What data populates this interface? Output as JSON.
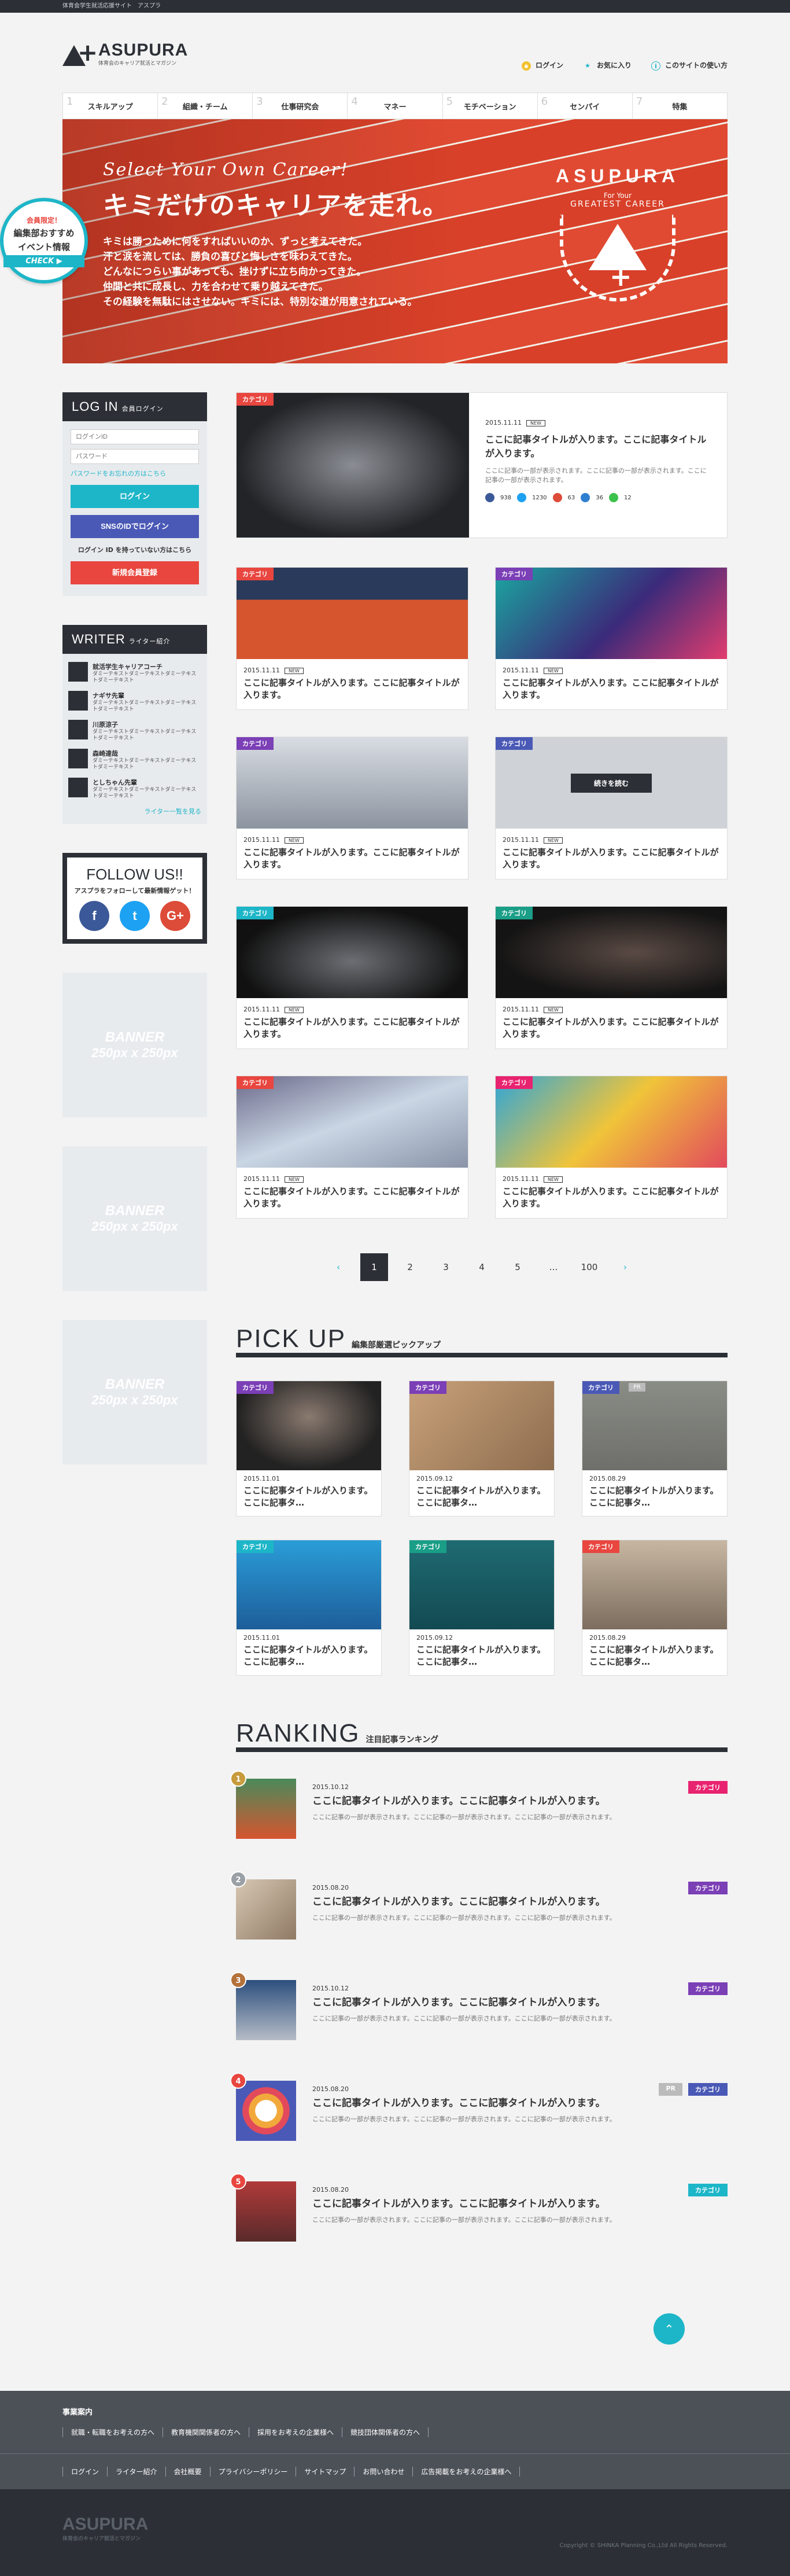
{
  "topbar": {
    "text": "体育会学生就活応援サイト　アスプラ"
  },
  "header": {
    "logo": "ASUPURA",
    "logo_sub": "体育会のキャリア就活とマガジン",
    "links": [
      {
        "label": "ログイン",
        "icon": "lock-icon"
      },
      {
        "label": "お気に入り",
        "icon": "star-icon"
      },
      {
        "label": "このサイトの使い方",
        "icon": "info-icon"
      }
    ]
  },
  "nav": [
    {
      "num": "1",
      "label": "スキルアップ"
    },
    {
      "num": "2",
      "label": "組織・チーム"
    },
    {
      "num": "3",
      "label": "仕事研究会"
    },
    {
      "num": "4",
      "label": "マネー"
    },
    {
      "num": "5",
      "label": "モチベーション"
    },
    {
      "num": "6",
      "label": "センパイ"
    },
    {
      "num": "7",
      "label": "特集"
    }
  ],
  "hero": {
    "en": "Select Your Own Career!",
    "title": "キミだけのキャリアを走れ。",
    "lines": [
      "キミは勝つために何をすればいいのか、ずっと考えてきた。",
      "汗と涙を流しては、勝負の喜びと悔しさを味わえてきた。",
      "どんなにつらい事があっても、挫けずに立ち向かってきた。",
      "仲間と共に成長し、力を合わせて乗り越えてきた。",
      "その経験を無駄にはさせない。キミには、特別な道が用意されている。"
    ],
    "badge_arc": "ASUPURA",
    "badge_for": "For Your",
    "badge_great": "GREATEST CAREER"
  },
  "side_tab": {
    "limited": "会員限定！",
    "title1": "編集部おすすめ",
    "title2": "イベント情報",
    "check": "CHECK ▶"
  },
  "login": {
    "title": "LOG IN",
    "title_sub": "会員ログイン",
    "id_placeholder": "ログインID",
    "pw_placeholder": "パスワード",
    "forgot": "パスワードをお忘れの方はこちら",
    "login_btn": "ログイン",
    "sns_btn": "SNSのIDでログイン",
    "note": "ログイン ID を持っていない方はこちら",
    "register_btn": "新規会員登録"
  },
  "writer": {
    "title": "WRITER",
    "title_sub": "ライター紹介",
    "items": [
      {
        "name": "就活学生キャリアコーチ",
        "desc": "ダミーテキストダミーテキストダミーテキストダミーテキスト"
      },
      {
        "name": "ナギサ先輩",
        "desc": "ダミーテキストダミーテキストダミーテキストダミーテキスト"
      },
      {
        "name": "川原涼子",
        "desc": "ダミーテキストダミーテキストダミーテキストダミーテキスト"
      },
      {
        "name": "森崎達哉",
        "desc": "ダミーテキストダミーテキストダミーテキストダミーテキスト"
      },
      {
        "name": "としちゃん先輩",
        "desc": "ダミーテキストダミーテキストダミーテキストダミーテキスト"
      }
    ],
    "more": "ライター一覧を見る"
  },
  "follow": {
    "title": "FOLLOW US!!",
    "sub": "アスプラをフォローして最新情報ゲット！",
    "sns": [
      "f",
      "t",
      "G+"
    ]
  },
  "banner": {
    "line1": "BANNER",
    "line2": "250px x 250px"
  },
  "featured": {
    "cat": "カテゴリ",
    "date": "2015.11.11",
    "new": "NEW",
    "title": "ここに記事タイトルが入ります。ここに記事タイトルが入ります。",
    "text": "ここに記事の一部が表示されます。ここに記事の一部が表示されます。ここに記事の一部が表示されます。",
    "counts": [
      "938",
      "1230",
      "63",
      "36",
      "12"
    ]
  },
  "articles": [
    {
      "cat": "カテゴリ",
      "cat_color": "#e8463f",
      "date": "2015.11.11",
      "new": "NEW",
      "title": "ここに記事タイトルが入ります。ここに記事タイトルが入ります。"
    },
    {
      "cat": "カテゴリ",
      "cat_color": "#7b3fb6",
      "date": "2015.11.11",
      "new": "NEW",
      "title": "ここに記事タイトルが入ります。ここに記事タイトルが入ります。"
    },
    {
      "cat": "カテゴリ",
      "cat_color": "#7b3fb6",
      "date": "2015.11.11",
      "new": "NEW",
      "title": "ここに記事タイトルが入ります。ここに記事タイトルが入ります。"
    },
    {
      "cat": "カテゴリ",
      "cat_color": "#4a59b6",
      "date": "2015.11.11",
      "new": "NEW",
      "title": "ここに記事タイトルが入ります。ここに記事タイトルが入ります。",
      "overlay_btn": "続きを読む"
    },
    {
      "cat": "カテゴリ",
      "cat_color": "#1db6c8",
      "date": "2015.11.11",
      "new": "NEW",
      "title": "ここに記事タイトルが入ります。ここに記事タイトルが入ります。"
    },
    {
      "cat": "カテゴリ",
      "cat_color": "#1a9e87",
      "date": "2015.11.11",
      "new": "NEW",
      "title": "ここに記事タイトルが入ります。ここに記事タイトルが入ります。"
    },
    {
      "cat": "カテゴリ",
      "cat_color": "#e8463f",
      "date": "2015.11.11",
      "new": "NEW",
      "title": "ここに記事タイトルが入ります。ここに記事タイトルが入ります。"
    },
    {
      "cat": "カテゴリ",
      "cat_color": "#e8236f",
      "date": "2015.11.11",
      "new": "NEW",
      "title": "ここに記事タイトルが入ります。ここに記事タイトルが入ります。"
    }
  ],
  "pager": {
    "prev": "‹",
    "pages": [
      "1",
      "2",
      "3",
      "4",
      "5",
      "…",
      "100"
    ],
    "next": "›"
  },
  "pickup": {
    "en": "PICK UP",
    "jp": "編集部厳選ピックアップ",
    "items": [
      {
        "cat": "カテゴリ",
        "cat_color": "#7b3fb6",
        "date": "2015.11.01",
        "title": "ここに記事タイトルが入ります。ここに記事タ…"
      },
      {
        "cat": "カテゴリ",
        "cat_color": "#7b3fb6",
        "date": "2015.09.12",
        "title": "ここに記事タイトルが入ります。ここに記事タ…"
      },
      {
        "cat": "カテゴリ",
        "cat_color": "#4a59b6",
        "date": "2015.08.29",
        "title": "ここに記事タイトルが入ります。ここに記事タ…",
        "pr": "PR"
      },
      {
        "cat": "カテゴリ",
        "cat_color": "#1db6c8",
        "date": "2015.11.01",
        "title": "ここに記事タイトルが入ります。ここに記事タ…"
      },
      {
        "cat": "カテゴリ",
        "cat_color": "#1a9e87",
        "date": "2015.09.12",
        "title": "ここに記事タイトルが入ります。ここに記事タ…"
      },
      {
        "cat": "カテゴリ",
        "cat_color": "#e8463f",
        "date": "2015.08.29",
        "title": "ここに記事タイトルが入ります。ここに記事タ…"
      }
    ]
  },
  "ranking": {
    "en": "RANKING",
    "jp": "注目記事ランキング",
    "items": [
      {
        "no": "1",
        "date": "2015.10.12",
        "tag": "カテゴリ",
        "tag_color": "#e8236f",
        "title": "ここに記事タイトルが入ります。ここに記事タイトルが入ります。",
        "text": "ここに記事の一部が表示されます。ここに記事の一部が表示されます。ここに記事の一部が表示されます。"
      },
      {
        "no": "2",
        "date": "2015.08.20",
        "tag": "カテゴリ",
        "tag_color": "#7b3fb6",
        "title": "ここに記事タイトルが入ります。ここに記事タイトルが入ります。",
        "text": "ここに記事の一部が表示されます。ここに記事の一部が表示されます。ここに記事の一部が表示されます。"
      },
      {
        "no": "3",
        "date": "2015.10.12",
        "tag": "カテゴリ",
        "tag_color": "#7b3fb6",
        "title": "ここに記事タイトルが入ります。ここに記事タイトルが入ります。",
        "text": "ここに記事の一部が表示されます。ここに記事の一部が表示されます。ここに記事の一部が表示されます。"
      },
      {
        "no": "4",
        "date": "2015.08.20",
        "tag": "カテゴリ",
        "tag_color": "#4a59b6",
        "pr": "PR",
        "title": "ここに記事タイトルが入ります。ここに記事タイトルが入ります。",
        "text": "ここに記事の一部が表示されます。ここに記事の一部が表示されます。ここに記事の一部が表示されます。"
      },
      {
        "no": "5",
        "date": "2015.08.20",
        "tag": "カテゴリ",
        "tag_color": "#1db6c8",
        "title": "ここに記事タイトルが入ります。ここに記事タイトルが入ります。",
        "text": "ここに記事の一部が表示されます。ここに記事の一部が表示されます。ここに記事の一部が表示されます。"
      }
    ]
  },
  "totop": "⌃",
  "footer": {
    "heading": "事業案内",
    "links1": [
      "就職・転職をお考えの方へ",
      "教育機関関係者の方へ",
      "採用をお考えの企業様へ",
      "競技団体関係者の方へ"
    ],
    "links2": [
      "ログイン",
      "ライター紹介",
      "会社概要",
      "プライバシーポリシー",
      "サイトマップ",
      "お問い合わせ",
      "広告掲載をお考えの企業様へ"
    ],
    "logo": "ASUPURA",
    "logo_sub": "体育会のキャリア就活とマガジン",
    "copy": "Copyright © SHINKA Planning Co.,Ltd All Rights Reserved."
  },
  "colors": {
    "dark": "#2c3036",
    "cyan": "#1db6c8",
    "red": "#e8463f",
    "purple": "#7b3fb6",
    "indigo": "#4a59b6"
  }
}
